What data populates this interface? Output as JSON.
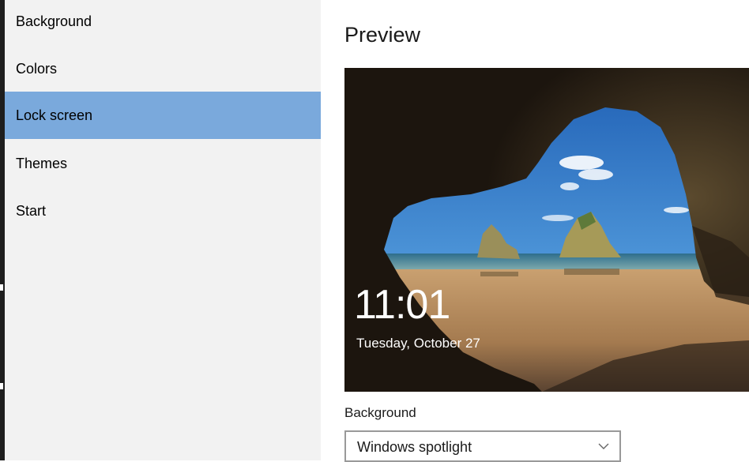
{
  "sidebar": {
    "items": [
      {
        "label": "Background",
        "selected": false
      },
      {
        "label": "Colors",
        "selected": false
      },
      {
        "label": "Lock screen",
        "selected": true
      },
      {
        "label": "Themes",
        "selected": false
      },
      {
        "label": "Start",
        "selected": false
      }
    ],
    "selected_color": "#7aa9dc"
  },
  "main": {
    "preview_title": "Preview",
    "lock_preview": {
      "time": "11:01",
      "date": "Tuesday, October 27"
    },
    "background_label": "Background",
    "background_dropdown": {
      "value": "Windows spotlight",
      "icon": "chevron-down-icon"
    }
  }
}
